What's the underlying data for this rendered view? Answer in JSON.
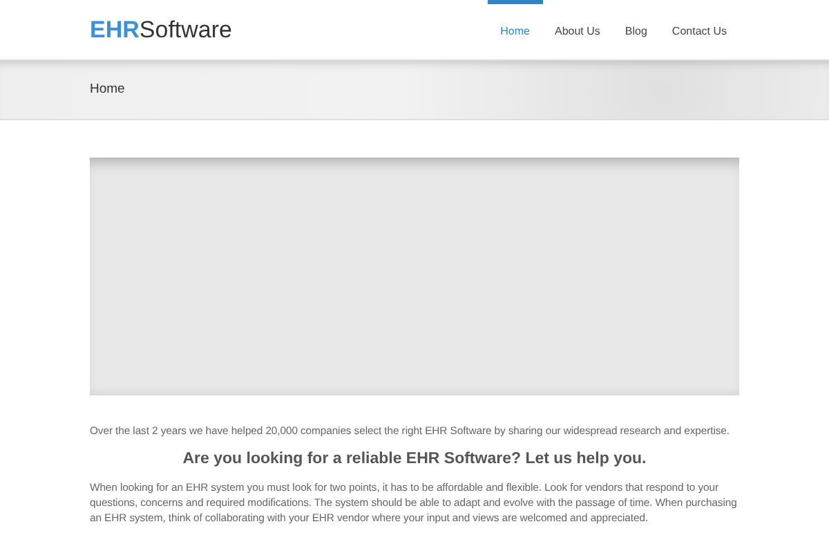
{
  "logo": {
    "accent": "EHR",
    "text": "Software"
  },
  "nav": [
    {
      "label": "Home",
      "selected": true
    },
    {
      "label": "About Us",
      "selected": false
    },
    {
      "label": "Blog",
      "selected": false
    },
    {
      "label": "Contact Us",
      "selected": false
    }
  ],
  "breadcrumb": "Home",
  "intro": "Over the last 2 years we have helped 20,000 companies select the right EHR Software by sharing our widespread research and expertise.",
  "heading": "Are you looking for a reliable EHR Software? **Let us help you.**",
  "body": "When looking for an EHR system you must look for two points, it has to be affordable and flexible. Look for vendors that respond to your questions, concerns and required modifications. The system should be able to adapt and evolve with the passage of time. When purchasing an EHR system, think of collaborating with your EHR vendor where your input and views are welcomed and appreciated."
}
